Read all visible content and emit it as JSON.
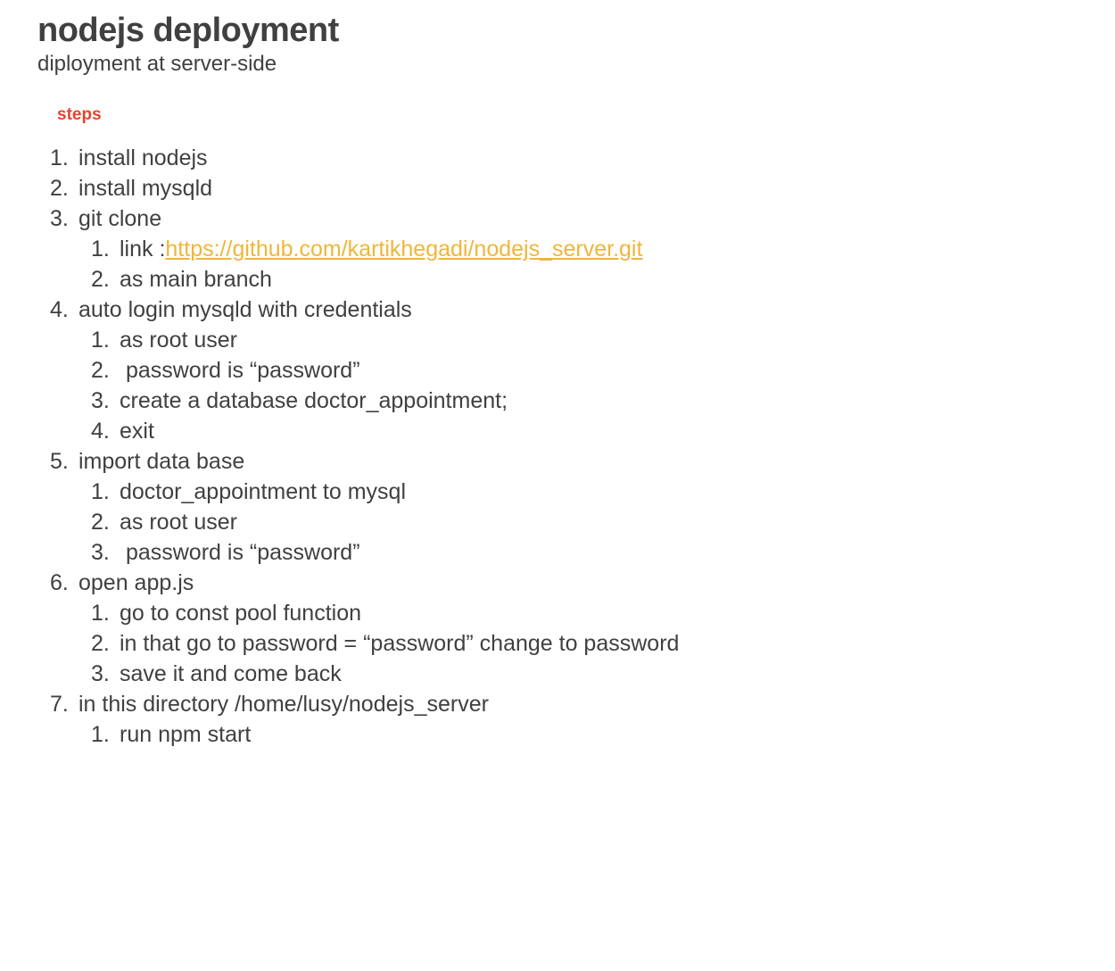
{
  "document": {
    "title": "nodejs deployment",
    "subtitle": "diployment at server-side",
    "section_label": "steps",
    "steps": [
      {
        "num": "1.",
        "text": "install nodejs",
        "substeps": []
      },
      {
        "num": "2.",
        "text": "install mysqld",
        "substeps": []
      },
      {
        "num": "3.",
        "text": "git clone",
        "substeps": [
          {
            "num": "1.",
            "text": "link :",
            "link": "https://github.com/kartikhegadi/nodejs_server.git"
          },
          {
            "num": "2.",
            "text": "as main branch"
          }
        ]
      },
      {
        "num": "4.",
        "text": "auto login mysqld with credentials",
        "substeps": [
          {
            "num": "1.",
            "text": "as root user"
          },
          {
            "num": "2.",
            "text": " password is “password”"
          },
          {
            "num": "3.",
            "text": "create a database doctor_appointment;"
          },
          {
            "num": "4.",
            "text": "exit"
          }
        ]
      },
      {
        "num": "5.",
        "text": "import data base",
        "substeps": [
          {
            "num": "1.",
            "text": "doctor_appointment to mysql"
          },
          {
            "num": "2.",
            "text": "as root user"
          },
          {
            "num": "3.",
            "text": " password is “password”"
          }
        ]
      },
      {
        "num": "6.",
        "text": "open app.js",
        "substeps": [
          {
            "num": "1.",
            "text": "go to const pool function"
          },
          {
            "num": "2.",
            "text": "in that go to password = “password” change to password"
          },
          {
            "num": "3.",
            "text": "save it and come back"
          }
        ]
      },
      {
        "num": "7.",
        "text": "in this directory  /home/lusy/nodejs_server",
        "substeps": [
          {
            "num": "1.",
            "text": "run npm start"
          }
        ]
      }
    ]
  },
  "colors": {
    "text": "#404040",
    "section_label": "#e5442b",
    "link": "#f0b63a",
    "background": "#ffffff"
  }
}
